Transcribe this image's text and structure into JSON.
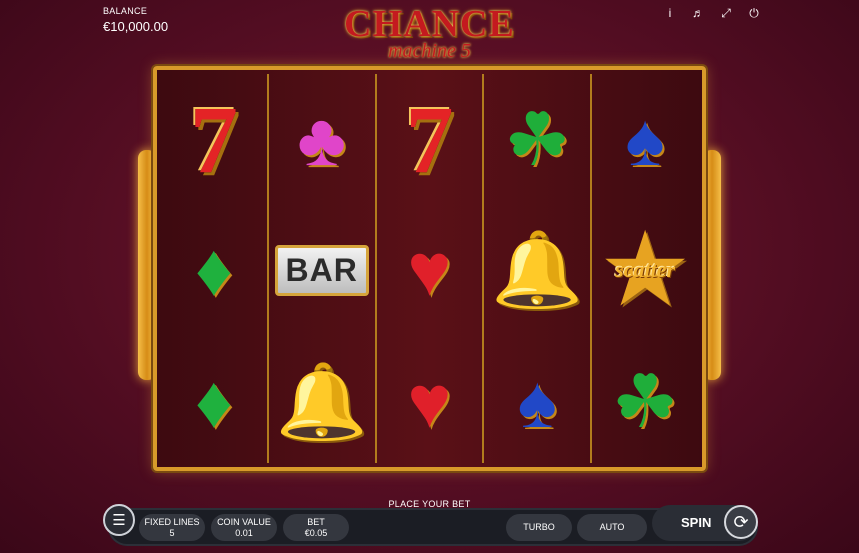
{
  "header": {
    "balance_label": "BALANCE",
    "balance_value": "€10,000.00",
    "icons": [
      "info-icon",
      "sound-icon",
      "fullscreen-icon",
      "power-icon"
    ]
  },
  "logo": {
    "line1": "CHANCE",
    "line2": "machine 5"
  },
  "reels": [
    [
      "seven",
      "diamond",
      "diamond"
    ],
    [
      "club",
      "bar",
      "bell"
    ],
    [
      "seven",
      "heart",
      "heart"
    ],
    [
      "clover",
      "bell",
      "spade"
    ],
    [
      "spade",
      "scatter",
      "clover"
    ]
  ],
  "symbol_text": {
    "bar": "BAR",
    "scatter": "scatter"
  },
  "controls": {
    "status": "PLACE YOUR BET",
    "fixed_lines_label": "FIXED LINES",
    "fixed_lines_value": "5",
    "coin_value_label": "COIN VALUE",
    "coin_value_value": "0.01",
    "bet_label": "BET",
    "bet_value": "€0.05",
    "turbo_label": "TURBO",
    "auto_label": "AUTO",
    "spin_label": "SPIN"
  },
  "colors": {
    "background": "#5a0f25",
    "frame_gold": "#d89a2a",
    "console": "#1b1d24"
  }
}
